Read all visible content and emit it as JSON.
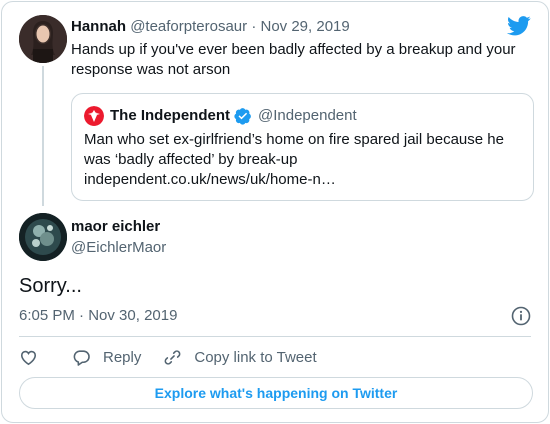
{
  "parent_tweet": {
    "name": "Hannah",
    "handle": "@teaforpterosaur",
    "separator": "·",
    "date": "Nov 29, 2019",
    "text": "Hands up if you've ever been badly affected by a breakup and your response was not arson",
    "quote": {
      "name": "The Independent",
      "handle": "@Independent",
      "text": "Man who set ex-girlfriend’s home on fire spared jail because he was ‘badly affected’ by break-up",
      "link": "independent.co.uk/news/uk/home-n…"
    }
  },
  "main_tweet": {
    "name": "maor eichler",
    "handle": "@EichlerMaor",
    "text": "Sorry...",
    "time": "6:05 PM",
    "separator": "·",
    "date": "Nov 30, 2019"
  },
  "actions": {
    "reply_label": "Reply",
    "copy_label": "Copy link to Tweet"
  },
  "explore_label": "Explore what's happening on Twitter",
  "colors": {
    "brand": "#1d9bf0",
    "independent_red": "#ec1a2e",
    "text": "#0f1419",
    "muted": "#536471",
    "border": "#cfd9de"
  },
  "icons": {
    "logo": "twitter-bird-icon",
    "verified": "verified-badge-icon",
    "info": "info-icon",
    "like": "heart-icon",
    "reply": "reply-bubble-icon",
    "copy": "link-icon"
  }
}
